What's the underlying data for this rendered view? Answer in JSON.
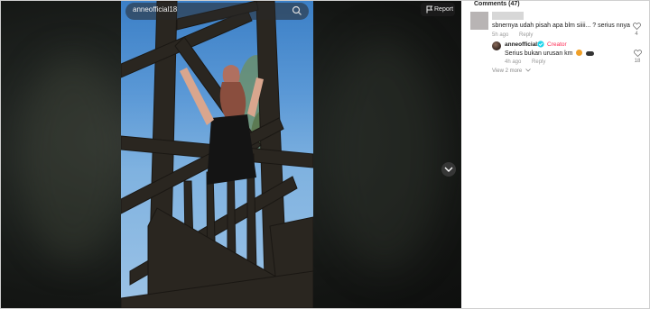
{
  "player": {
    "username": "anneofficial18",
    "report_label": "Report"
  },
  "comments": {
    "header": "Comments (47)",
    "items": [
      {
        "text": "sbnernya udah pisah apa blm siiii... ? serius nnya",
        "time": "5h ago",
        "reply_label": "Reply",
        "likes": "4",
        "author_redacted": true
      }
    ],
    "reply": {
      "author": "anneofficial18",
      "badge": "Creator",
      "text": "Serius bukan urusan km",
      "emojis": [
        "angry-face",
        "sunglasses-face"
      ],
      "time": "4h ago",
      "reply_label": "Reply",
      "likes": "18"
    },
    "view_more": "View 2 more"
  },
  "colors": {
    "accent_creator": "#fe2c55",
    "verified": "#20d5ec"
  },
  "icons": {
    "search": "search-icon",
    "flag": "flag-icon",
    "chevron_down": "chevron-down-icon",
    "heart": "heart-icon",
    "verified": "verified-badge-icon"
  }
}
